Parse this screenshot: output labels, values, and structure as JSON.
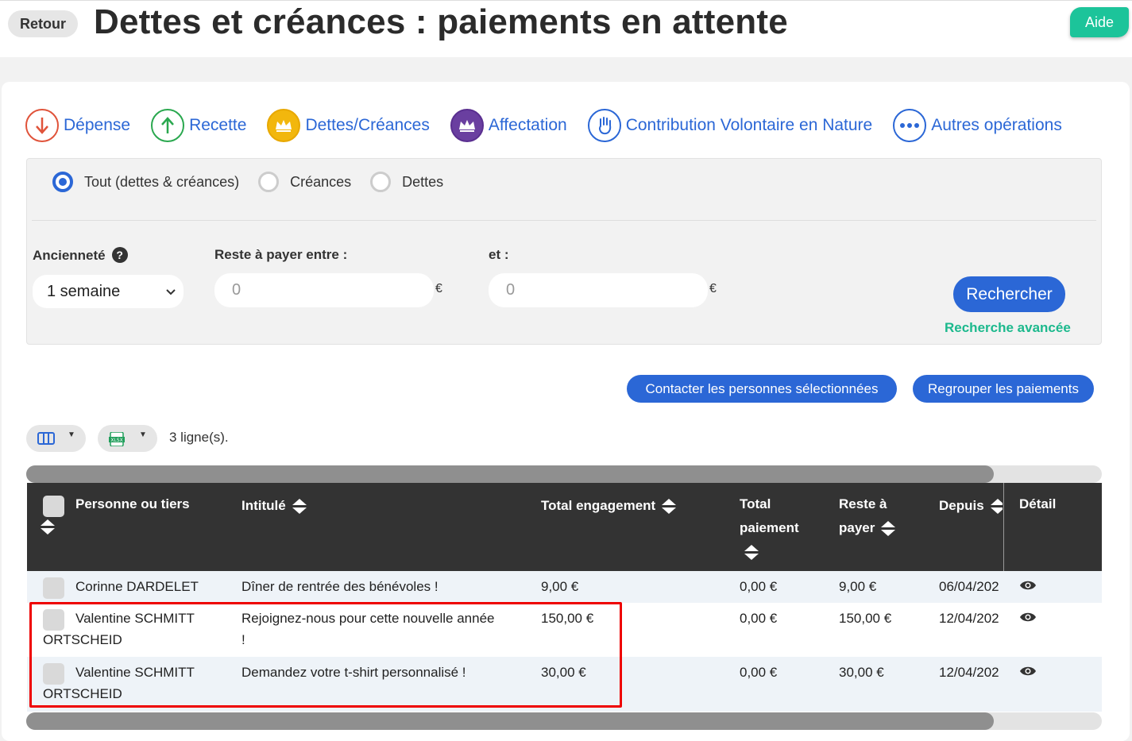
{
  "header": {
    "back_label": "Retour",
    "title": "Dettes et créances : paiements en attente",
    "help_label": "Aide"
  },
  "operations": [
    {
      "label": "Dépense",
      "icon": "arrow-down-icon",
      "color": "#e0533a"
    },
    {
      "label": "Recette",
      "icon": "arrow-up-icon",
      "color": "#2aa84f"
    },
    {
      "label": "Dettes/Créances",
      "icon": "crown-icon",
      "color": "#f2b70d"
    },
    {
      "label": "Affectation",
      "icon": "crown-transfer-icon",
      "color": "#6a3fa0"
    },
    {
      "label": "Contribution Volontaire en Nature",
      "icon": "hand-icon",
      "color": "#2b67d6"
    },
    {
      "label": "Autres opérations",
      "icon": "more-dots-icon",
      "color": "#2b67d6"
    }
  ],
  "filters": {
    "radios": [
      {
        "label": "Tout (dettes & créances)",
        "selected": true
      },
      {
        "label": "Créances",
        "selected": false
      },
      {
        "label": "Dettes",
        "selected": false
      }
    ],
    "anciennete_label": "Ancienneté",
    "anciennete_value": "1 semaine",
    "reste_label": "Reste à payer entre :",
    "reste_min_placeholder": "0",
    "et_label": "et :",
    "reste_max_placeholder": "0",
    "currency": "€",
    "search_label": "Rechercher",
    "advanced_label": "Recherche avancée"
  },
  "actions": {
    "contact_label": "Contacter les personnes sélectionnées",
    "group_label": "Regrouper les paiements"
  },
  "table": {
    "row_count": "3 ligne(s).",
    "headers": {
      "person": "Personne ou tiers",
      "title": "Intitulé",
      "total_engagement": "Total engagement",
      "total_paiement_1": "Total",
      "total_paiement_2": "paiement",
      "reste_1": "Reste à",
      "reste_2": "payer",
      "depuis": "Depuis",
      "detail": "Détail"
    },
    "rows": [
      {
        "person_1": "Corinne DARDELET",
        "person_2": "",
        "title_1": "Dîner de rentrée des bénévoles !",
        "title_2": "",
        "engagement": "9,00 €",
        "paiement": "0,00 €",
        "reste": "9,00 €",
        "depuis": "06/04/202"
      },
      {
        "person_1": "Valentine SCHMITT",
        "person_2": "ORTSCHEID",
        "title_1": "Rejoignez-nous pour cette nouvelle année",
        "title_2": "!",
        "engagement": "150,00 €",
        "paiement": "0,00 €",
        "reste": "150,00 €",
        "depuis": "12/04/202"
      },
      {
        "person_1": "Valentine SCHMITT",
        "person_2": "ORTSCHEID",
        "title_1": "Demandez votre t-shirt personnalisé !",
        "title_2": "",
        "engagement": "30,00 €",
        "paiement": "0,00 €",
        "reste": "30,00 €",
        "depuis": "12/04/202"
      }
    ]
  },
  "colors": {
    "primary": "#2b67d6",
    "accent_green": "#1cc49a",
    "header_dark": "#333333",
    "highlight_red": "#e00000"
  }
}
